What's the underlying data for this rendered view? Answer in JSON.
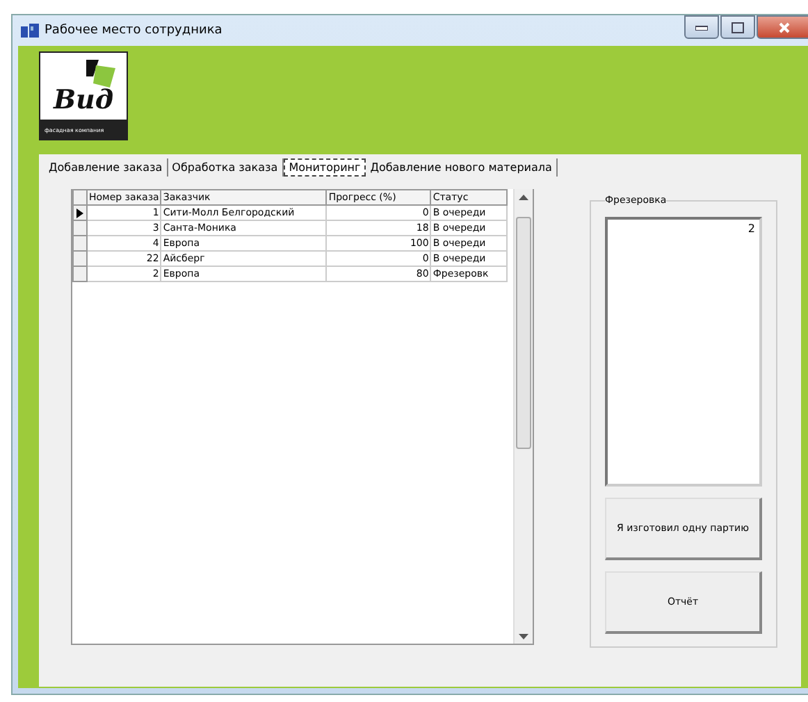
{
  "window": {
    "title": "Рабочее место сотрудника"
  },
  "logo": {
    "name": "Вид",
    "tagline": "фасадная компания"
  },
  "tabs": [
    {
      "label": "Добавление заказа",
      "selected": false
    },
    {
      "label": "Обработка заказа",
      "selected": false
    },
    {
      "label": "Мониторинг",
      "selected": true
    },
    {
      "label": "Добавление нового материала",
      "selected": false
    }
  ],
  "table": {
    "columns": [
      "Номер заказа",
      "Заказчик",
      "Прогресс (%)",
      "Статус"
    ],
    "rows": [
      {
        "cells": [
          "1",
          "Сити-Молл Белгородский",
          "0",
          "В очереди"
        ],
        "selected": true
      },
      {
        "cells": [
          "3",
          "Санта-Моника",
          "18",
          "В очереди"
        ],
        "selected": false
      },
      {
        "cells": [
          "4",
          "Европа",
          "100",
          "В очереди"
        ],
        "selected": false
      },
      {
        "cells": [
          "22",
          "Айсберг",
          "0",
          "В очереди"
        ],
        "selected": false
      },
      {
        "cells": [
          "2",
          "Европа",
          "80",
          "Фрезеровк"
        ],
        "selected": false
      }
    ]
  },
  "group": {
    "title": "Фрезеровка",
    "list_items": [
      "2"
    ],
    "buttons": [
      "Я изготовил одну партию",
      "Отчёт"
    ]
  }
}
